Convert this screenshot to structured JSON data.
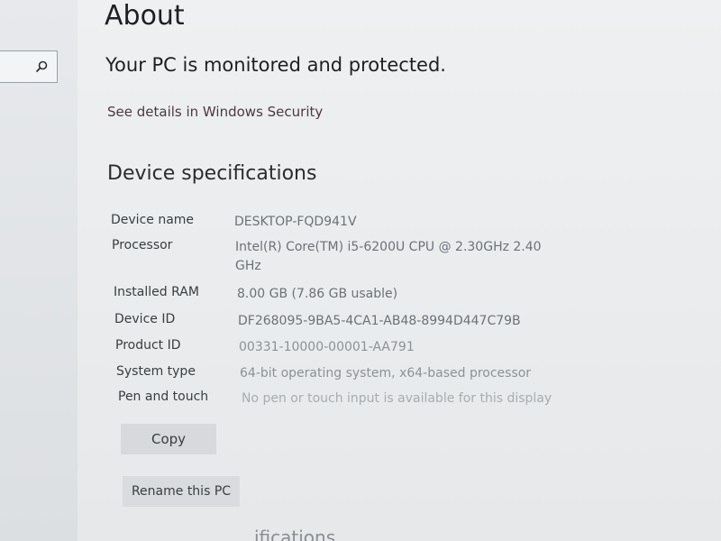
{
  "page": {
    "title": "About"
  },
  "security": {
    "status": "Your PC is monitored and protected.",
    "details_link": "See details in Windows Security"
  },
  "device_specifications": {
    "heading": "Device specifications",
    "rows": [
      {
        "label": "Device name",
        "value": "DESKTOP-FQD941V"
      },
      {
        "label": "Processor",
        "value": "Intel(R) Core(TM) i5-6200U CPU @ 2.30GHz   2.40 GHz"
      },
      {
        "label": "Installed RAM",
        "value": "8.00 GB (7.86 GB usable)"
      },
      {
        "label": "Device ID",
        "value": "DF268095-9BA5-4CA1-AB48-8994D447C79B"
      },
      {
        "label": "Product ID",
        "value": "00331-10000-00001-AA791"
      },
      {
        "label": "System type",
        "value": "64-bit operating system, x64-based processor"
      },
      {
        "label": "Pen and touch",
        "value": "No pen or touch input is available for this display"
      }
    ]
  },
  "buttons": {
    "copy": "Copy",
    "rename": "Rename this PC"
  },
  "footer": {
    "partial_heading": "ifications"
  },
  "icons": {
    "search": "search-icon"
  }
}
